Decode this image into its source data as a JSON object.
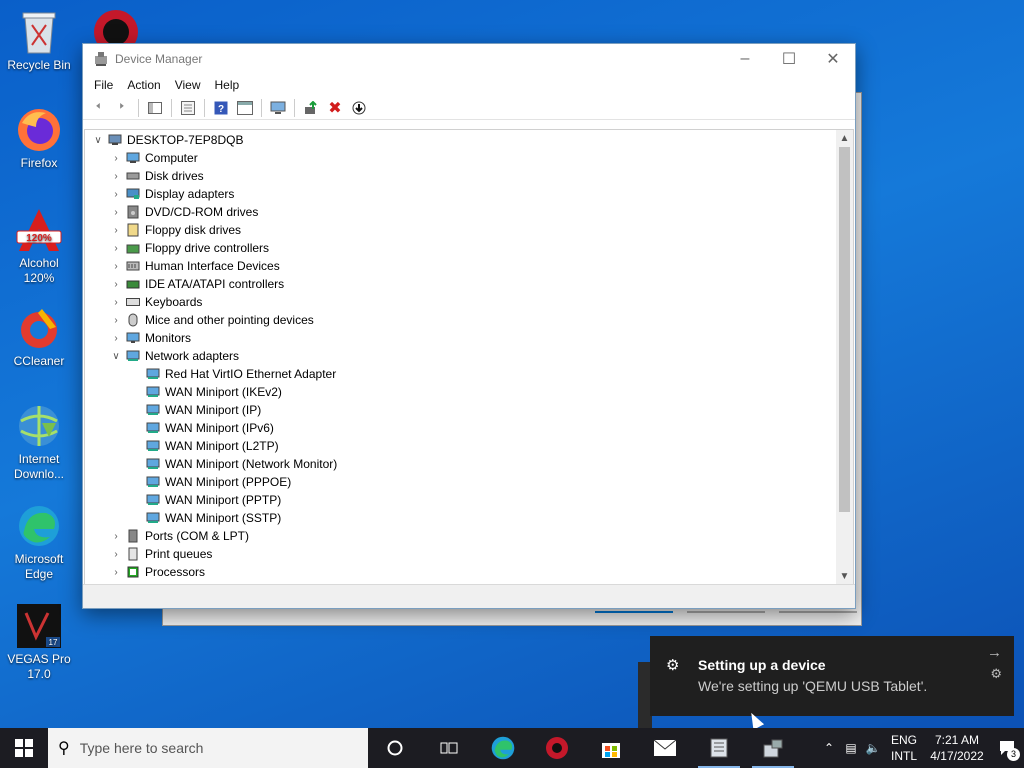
{
  "desktop": {
    "icons": [
      {
        "label": "Recycle Bin",
        "icon": "recycle-bin-icon"
      },
      {
        "label": "Firefox",
        "icon": "firefox-icon"
      },
      {
        "label": "Alcohol 120%",
        "icon": "alcohol-icon"
      },
      {
        "label": "CCleaner",
        "icon": "ccleaner-icon"
      },
      {
        "label": "Internet Downlo...",
        "icon": "internet-download-icon"
      },
      {
        "label": "Microsoft Edge",
        "icon": "edge-icon"
      },
      {
        "label": "VEGAS Pro 17.0",
        "icon": "vegas-pro-icon"
      }
    ]
  },
  "window": {
    "title": "Device Manager",
    "menu": [
      "File",
      "Action",
      "View",
      "Help"
    ],
    "tree": {
      "root": "DESKTOP-7EP8DQB",
      "categories": [
        {
          "label": "Computer",
          "icon": "computer-icon"
        },
        {
          "label": "Disk drives",
          "icon": "disk-icon"
        },
        {
          "label": "Display adapters",
          "icon": "display-icon"
        },
        {
          "label": "DVD/CD-ROM drives",
          "icon": "dvd-icon"
        },
        {
          "label": "Floppy disk drives",
          "icon": "floppy-icon"
        },
        {
          "label": "Floppy drive controllers",
          "icon": "controller-icon"
        },
        {
          "label": "Human Interface Devices",
          "icon": "hid-icon"
        },
        {
          "label": "IDE ATA/ATAPI controllers",
          "icon": "ide-icon"
        },
        {
          "label": "Keyboards",
          "icon": "keyboard-icon"
        },
        {
          "label": "Mice and other pointing devices",
          "icon": "mouse-icon"
        },
        {
          "label": "Monitors",
          "icon": "monitor-icon"
        },
        {
          "label": "Network adapters",
          "icon": "network-icon"
        }
      ],
      "network_children": [
        "Red Hat VirtIO Ethernet Adapter",
        "WAN Miniport (IKEv2)",
        "WAN Miniport (IP)",
        "WAN Miniport (IPv6)",
        "WAN Miniport (L2TP)",
        "WAN Miniport (Network Monitor)",
        "WAN Miniport (PPPOE)",
        "WAN Miniport (PPTP)",
        "WAN Miniport (SSTP)"
      ],
      "after": [
        {
          "label": "Ports (COM & LPT)",
          "icon": "port-icon"
        },
        {
          "label": "Print queues",
          "icon": "printer-icon"
        },
        {
          "label": "Processors",
          "icon": "processor-icon"
        }
      ]
    }
  },
  "toast": {
    "title": "Setting up a device",
    "body": "We're setting up 'QEMU USB Tablet'."
  },
  "taskbar": {
    "search_placeholder": "Type here to search",
    "lang_line1": "ENG",
    "lang_line2": "INTL",
    "time": "7:21 AM",
    "date": "4/17/2022",
    "notification_count": "3"
  },
  "colors": {
    "accent": "#0078d7",
    "taskbar": "#1c1c22",
    "desktop": "#1579d9"
  }
}
